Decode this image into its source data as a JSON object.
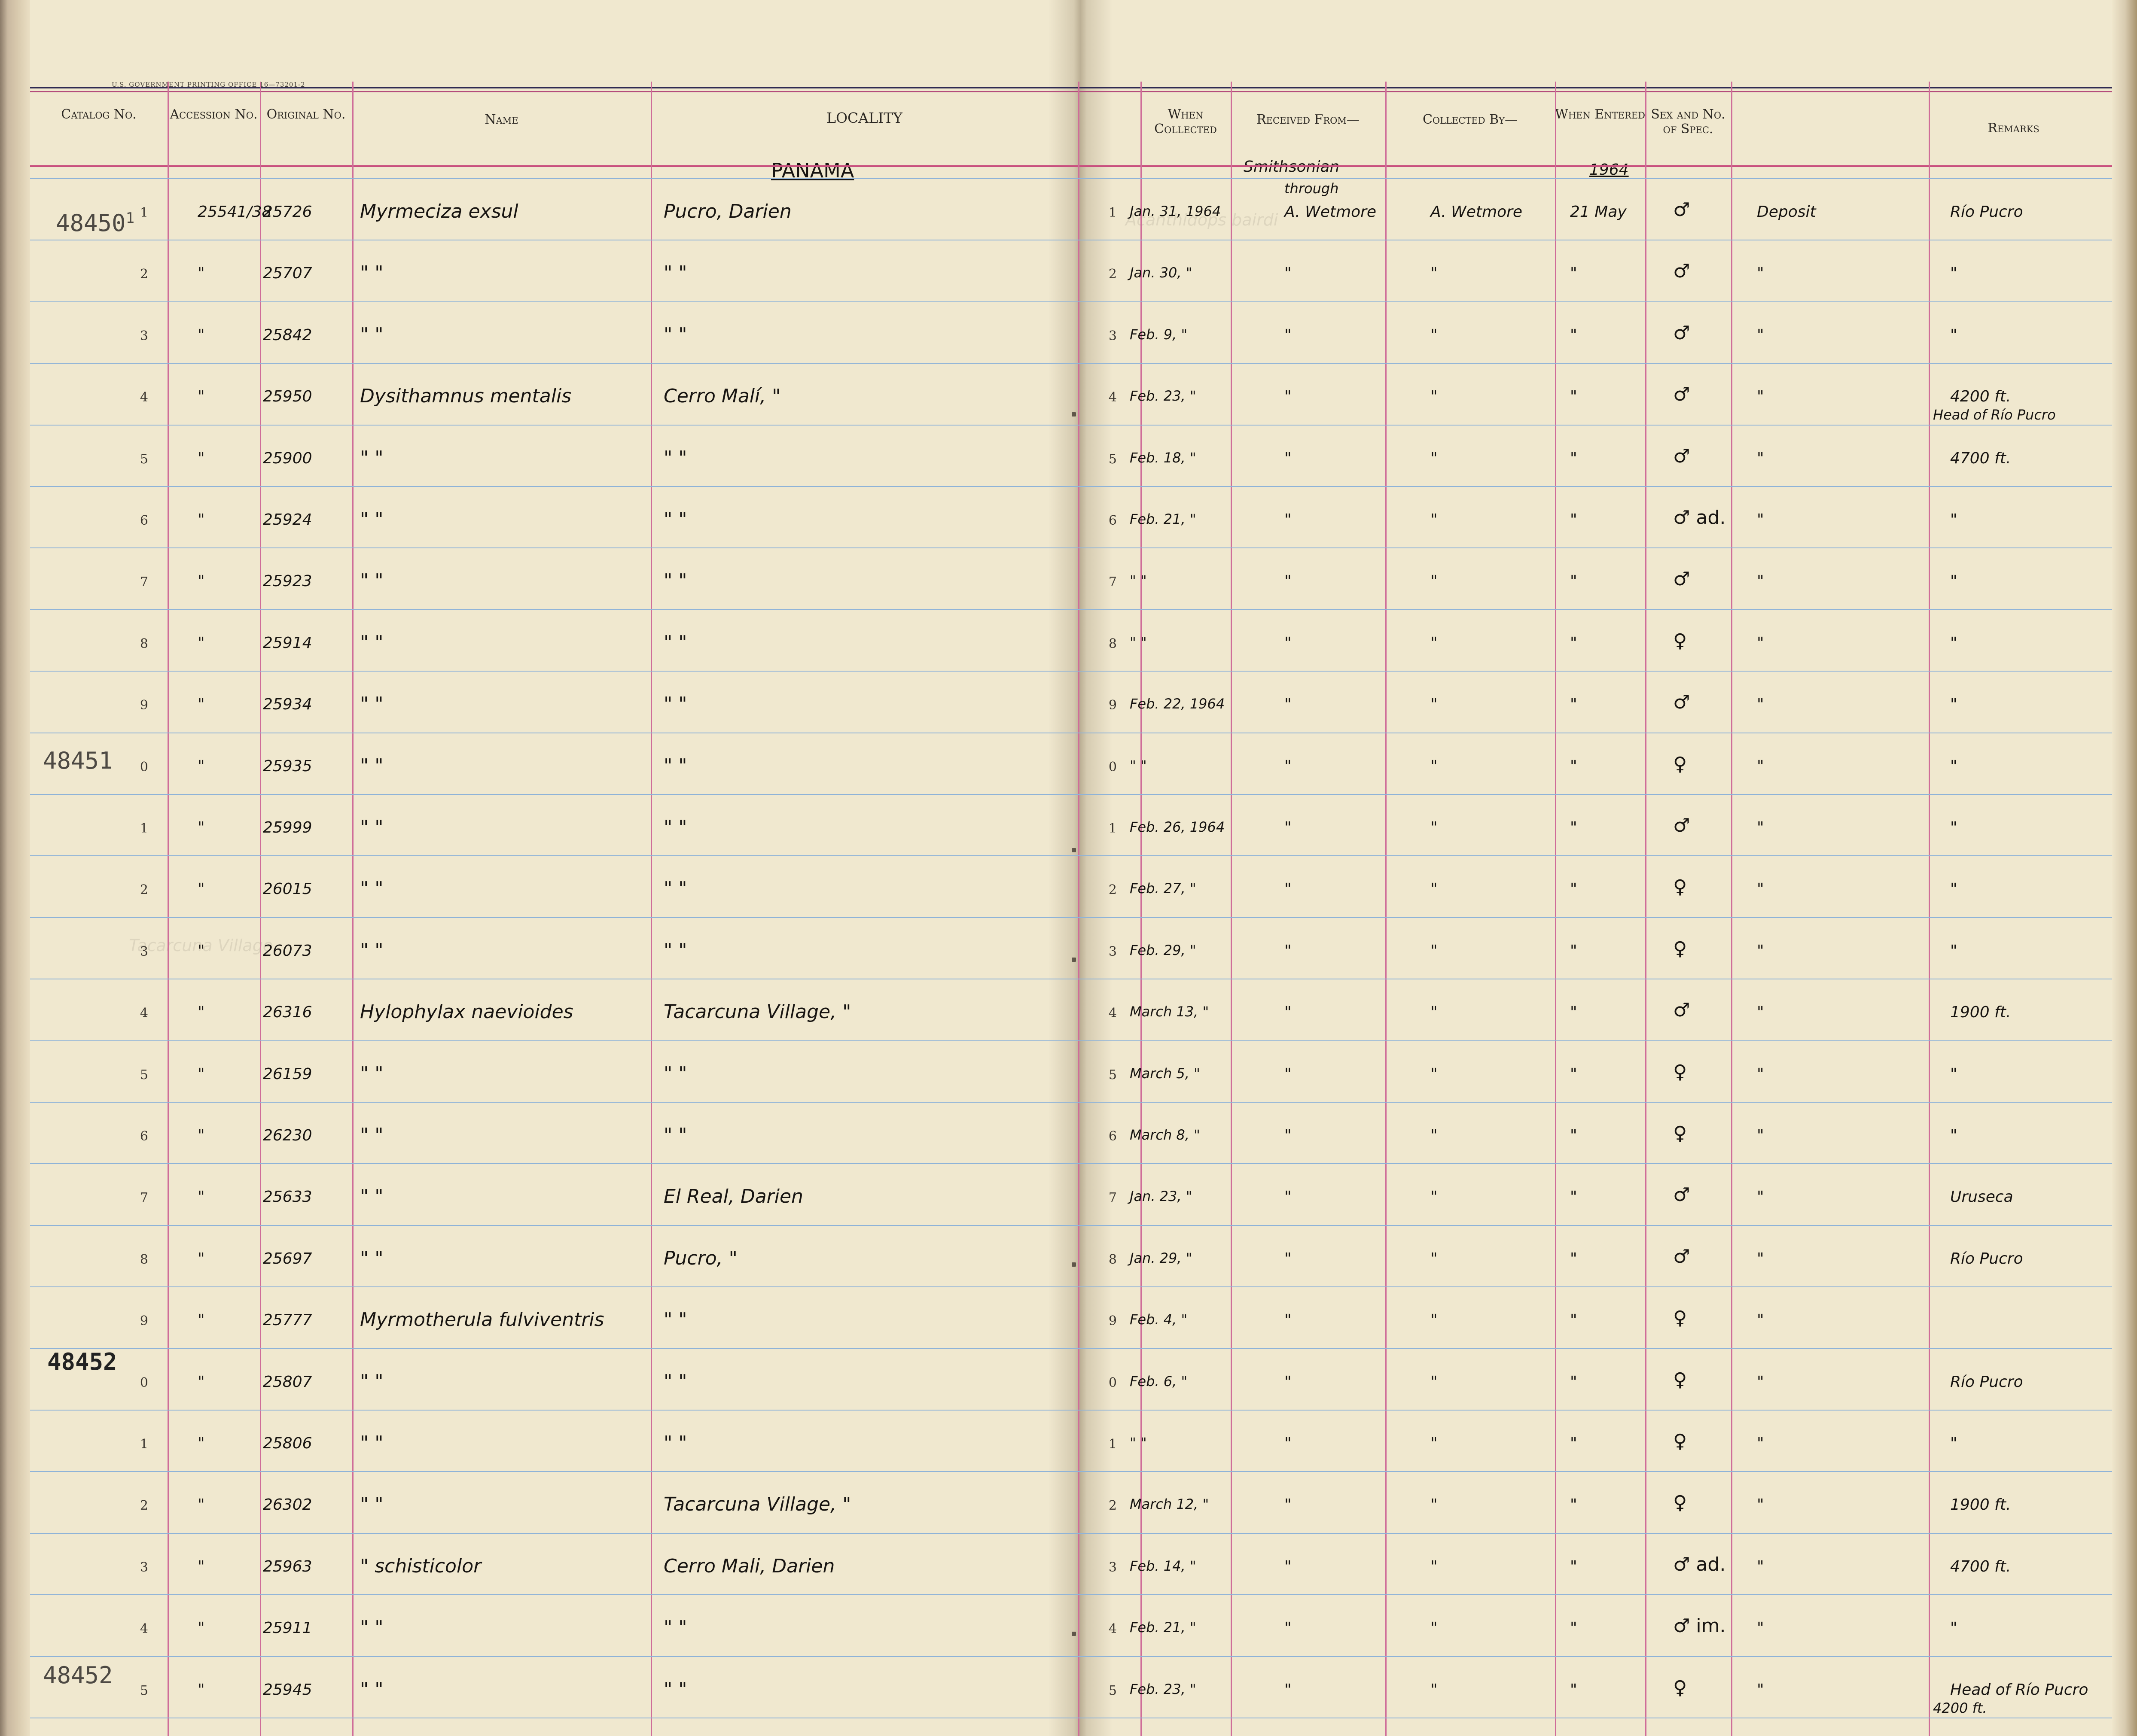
{
  "page_header": {
    "printer_line": "U.S. GOVERNMENT PRINTING OFFICE   16—73201-2"
  },
  "columns": {
    "catalog_no": "Catalog No.",
    "accession_no": "Accession No.",
    "original_no": "Original No.",
    "name": "Name",
    "locality": "LOCALITY",
    "when_collected": "When Collected",
    "received_from": "Received From—",
    "collected_by": "Collected By—",
    "when_entered": "When Entered",
    "sex_no": "Sex and No. of Spec.",
    "remarks": "Remarks"
  },
  "header_notes": {
    "country": "PANAMA",
    "received_note_1": "Smithsonian",
    "received_note_2": "through",
    "year": "1964"
  },
  "stamps": {
    "s1": "48450",
    "s1_sup": "1",
    "s2": "48451",
    "s3": "48452",
    "s4": "48452"
  },
  "rows": [
    {
      "n": "1",
      "acc": "25541/38",
      "orig": "25726",
      "name": "Myrmeciza exsul",
      "loc": "Pucro, Darien",
      "n2": "1",
      "date": "Jan. 31, 1964",
      "recv": "A. Wetmore",
      "coll": "A. Wetmore",
      "entered": "21 May",
      "sex": "♂",
      "extra": "Deposit",
      "rem": "Río Pucro",
      "rem2": ""
    },
    {
      "n": "2",
      "acc": "\"",
      "orig": "25707",
      "name": "\"        \"",
      "loc": "\"        \"",
      "n2": "2",
      "date": "Jan. 30,  \"",
      "recv": "\"",
      "coll": "\"",
      "entered": "\"",
      "sex": "♂",
      "extra": "\"",
      "rem": "\"",
      "rem2": ""
    },
    {
      "n": "3",
      "acc": "\"",
      "orig": "25842",
      "name": "\"        \"",
      "loc": "\"        \"",
      "n2": "3",
      "date": "Feb. 9,  \"",
      "recv": "\"",
      "coll": "\"",
      "entered": "\"",
      "sex": "♂",
      "extra": "\"",
      "rem": "\"",
      "rem2": ""
    },
    {
      "n": "4",
      "acc": "\"",
      "orig": "25950",
      "name": "Dysithamnus mentalis",
      "loc": "Cerro Malí,   \"",
      "n2": "4",
      "date": "Feb. 23,  \"",
      "recv": "\"",
      "coll": "\"",
      "entered": "\"",
      "sex": "♂",
      "extra": "\"",
      "rem": "4200 ft.",
      "rem2": "Head of Río Pucro"
    },
    {
      "n": "5",
      "acc": "\"",
      "orig": "25900",
      "name": "\"        \"",
      "loc": "\"        \"",
      "n2": "5",
      "date": "Feb. 18,  \"",
      "recv": "\"",
      "coll": "\"",
      "entered": "\"",
      "sex": "♂",
      "extra": "\"",
      "rem": "4700 ft.",
      "rem2": ""
    },
    {
      "n": "6",
      "acc": "\"",
      "orig": "25924",
      "name": "\"        \"",
      "loc": "\"        \"",
      "n2": "6",
      "date": "Feb. 21,  \"",
      "recv": "\"",
      "coll": "\"",
      "entered": "\"",
      "sex": "♂ ad.",
      "extra": "\"",
      "rem": "\"",
      "rem2": ""
    },
    {
      "n": "7",
      "acc": "\"",
      "orig": "25923",
      "name": "\"        \"",
      "loc": "\"        \"",
      "n2": "7",
      "date": "\"  \"",
      "recv": "\"",
      "coll": "\"",
      "entered": "\"",
      "sex": "♂",
      "extra": "\"",
      "rem": "\"",
      "rem2": ""
    },
    {
      "n": "8",
      "acc": "\"",
      "orig": "25914",
      "name": "\"        \"",
      "loc": "\"        \"",
      "n2": "8",
      "date": "\"  \"",
      "recv": "\"",
      "coll": "\"",
      "entered": "\"",
      "sex": "♀",
      "extra": "\"",
      "rem": "\"",
      "rem2": ""
    },
    {
      "n": "9",
      "acc": "\"",
      "orig": "25934",
      "name": "\"        \"",
      "loc": "\"        \"",
      "n2": "9",
      "date": "Feb. 22, 1964",
      "recv": "\"",
      "coll": "\"",
      "entered": "\"",
      "sex": "♂",
      "extra": "\"",
      "rem": "\"",
      "rem2": ""
    },
    {
      "n": "0",
      "acc": "\"",
      "orig": "25935",
      "name": "\"        \"",
      "loc": "\"        \"",
      "n2": "0",
      "date": "\"  \"",
      "recv": "\"",
      "coll": "\"",
      "entered": "\"",
      "sex": "♀",
      "extra": "\"",
      "rem": "\"",
      "rem2": ""
    },
    {
      "n": "1",
      "acc": "\"",
      "orig": "25999",
      "name": "\"        \"",
      "loc": "\"        \"",
      "n2": "1",
      "date": "Feb. 26, 1964",
      "recv": "\"",
      "coll": "\"",
      "entered": "\"",
      "sex": "♂",
      "extra": "\"",
      "rem": "\"",
      "rem2": ""
    },
    {
      "n": "2",
      "acc": "\"",
      "orig": "26015",
      "name": "\"        \"",
      "loc": "\"        \"",
      "n2": "2",
      "date": "Feb. 27,  \"",
      "recv": "\"",
      "coll": "\"",
      "entered": "\"",
      "sex": "♀",
      "extra": "\"",
      "rem": "\"",
      "rem2": ""
    },
    {
      "n": "3",
      "acc": "\"",
      "orig": "26073",
      "name": "\"        \"",
      "loc": "\"        \"",
      "n2": "3",
      "date": "Feb. 29,  \"",
      "recv": "\"",
      "coll": "\"",
      "entered": "\"",
      "sex": "♀",
      "extra": "\"",
      "rem": "\"",
      "rem2": ""
    },
    {
      "n": "4",
      "acc": "\"",
      "orig": "26316",
      "name": "Hylophylax naevioides",
      "loc": "Tacarcuna Village,  \"",
      "n2": "4",
      "date": "March 13,  \"",
      "recv": "\"",
      "coll": "\"",
      "entered": "\"",
      "sex": "♂",
      "extra": "\"",
      "rem": "1900 ft.",
      "rem2": ""
    },
    {
      "n": "5",
      "acc": "\"",
      "orig": "26159",
      "name": "\"        \"",
      "loc": "\"        \"",
      "n2": "5",
      "date": "March 5,  \"",
      "recv": "\"",
      "coll": "\"",
      "entered": "\"",
      "sex": "♀",
      "extra": "\"",
      "rem": "\"",
      "rem2": ""
    },
    {
      "n": "6",
      "acc": "\"",
      "orig": "26230",
      "name": "\"        \"",
      "loc": "\"        \"",
      "n2": "6",
      "date": "March 8,  \"",
      "recv": "\"",
      "coll": "\"",
      "entered": "\"",
      "sex": "♀",
      "extra": "\"",
      "rem": "\"",
      "rem2": ""
    },
    {
      "n": "7",
      "acc": "\"",
      "orig": "25633",
      "name": "\"        \"",
      "loc": "El Real, Darien",
      "n2": "7",
      "date": "Jan. 23,  \"",
      "recv": "\"",
      "coll": "\"",
      "entered": "\"",
      "sex": "♂",
      "extra": "\"",
      "rem": "Uruseca",
      "rem2": ""
    },
    {
      "n": "8",
      "acc": "\"",
      "orig": "25697",
      "name": "\"        \"",
      "loc": "Pucro,       \"",
      "n2": "8",
      "date": "Jan. 29,  \"",
      "recv": "\"",
      "coll": "\"",
      "entered": "\"",
      "sex": "♂",
      "extra": "\"",
      "rem": "Río Pucro",
      "rem2": ""
    },
    {
      "n": "9",
      "acc": "\"",
      "orig": "25777",
      "name": "Myrmotherula fulviventris",
      "loc": "\"        \"",
      "n2": "9",
      "date": "Feb. 4,  \"",
      "recv": "\"",
      "coll": "\"",
      "entered": "\"",
      "sex": "♀",
      "extra": "\"",
      "rem": "",
      "rem2": ""
    },
    {
      "n": "0",
      "acc": "\"",
      "orig": "25807",
      "name": "\"        \"",
      "loc": "\"        \"",
      "n2": "0",
      "date": "Feb. 6,  \"",
      "recv": "\"",
      "coll": "\"",
      "entered": "\"",
      "sex": "♀",
      "extra": "\"",
      "rem": "Río Pucro",
      "rem2": ""
    },
    {
      "n": "1",
      "acc": "\"",
      "orig": "25806",
      "name": "\"        \"",
      "loc": "\"        \"",
      "n2": "1",
      "date": "\"  \"",
      "recv": "\"",
      "coll": "\"",
      "entered": "\"",
      "sex": "♀",
      "extra": "\"",
      "rem": "\"",
      "rem2": ""
    },
    {
      "n": "2",
      "acc": "\"",
      "orig": "26302",
      "name": "\"        \"",
      "loc": "Tacarcuna Village,  \"",
      "n2": "2",
      "date": "March 12,  \"",
      "recv": "\"",
      "coll": "\"",
      "entered": "\"",
      "sex": "♀",
      "extra": "\"",
      "rem": "1900 ft.",
      "rem2": ""
    },
    {
      "n": "3",
      "acc": "\"",
      "orig": "25963",
      "name": "\" schisticolor",
      "loc": "Cerro Mali, Darien",
      "n2": "3",
      "date": "Feb. 14,  \"",
      "recv": "\"",
      "coll": "\"",
      "entered": "\"",
      "sex": "♂ ad.",
      "extra": "\"",
      "rem": "4700 ft.",
      "rem2": ""
    },
    {
      "n": "4",
      "acc": "\"",
      "orig": "25911",
      "name": "\"        \"",
      "loc": "\"        \"",
      "n2": "4",
      "date": "Feb. 21,  \"",
      "recv": "\"",
      "coll": "\"",
      "entered": "\"",
      "sex": "♂ im.",
      "extra": "\"",
      "rem": "\"",
      "rem2": ""
    },
    {
      "n": "5",
      "acc": "\"",
      "orig": "25945",
      "name": "\"        \"",
      "loc": "\"        \"",
      "n2": "5",
      "date": "Feb. 23,  \"",
      "recv": "\"",
      "coll": "\"",
      "entered": "\"",
      "sex": "♀",
      "extra": "\"",
      "rem": "Head of Río Pucro",
      "rem2": "4200 ft."
    }
  ]
}
